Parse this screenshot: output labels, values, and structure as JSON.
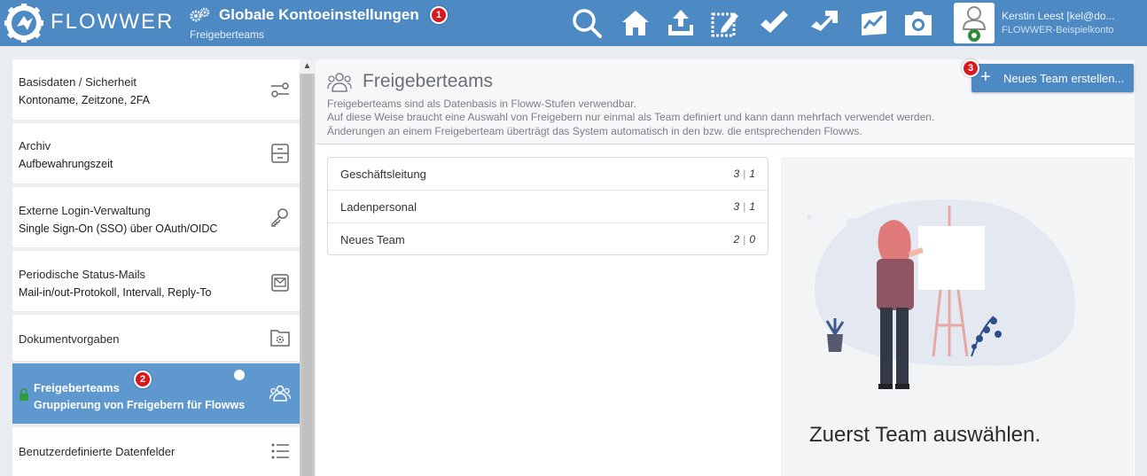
{
  "topbar": {
    "logo_text": "FLOWWER",
    "title": "Globale Kontoeinstellungen",
    "subtitle": "Freigeberteams",
    "icons": [
      "search-icon",
      "home-icon",
      "upload-icon",
      "select-icon",
      "edit-icon",
      "forward-icon",
      "chart-icon",
      "photo-icon"
    ],
    "user_name": "Kerstin Leest [kel@do...",
    "user_account": "FLOWWER-Beispielkonto"
  },
  "badges": {
    "b1": "1",
    "b2": "2",
    "b3": "3"
  },
  "sidebar": {
    "items": [
      {
        "title": "Basisdaten / Sicherheit",
        "sub": "Kontoname, Zeitzone, 2FA",
        "icon": "sliders-icon"
      },
      {
        "title": "Archiv",
        "sub": "Aufbewahrungszeit",
        "icon": "archive-icon"
      },
      {
        "title": "Externe Login-Verwaltung",
        "sub": "Single Sign-On (SSO) über OAuth/OIDC",
        "icon": "key-icon"
      },
      {
        "title": "Periodische Status-Mails",
        "sub": "Mail-in/out-Protokoll, Intervall, Reply-To",
        "icon": "mail-icon"
      },
      {
        "title": "Dokumentvorgaben",
        "sub": "",
        "icon": "folder-gear-icon"
      },
      {
        "title": "Freigeberteams",
        "sub": "Gruppierung von Freigebern für Flowws",
        "icon": "team-icon"
      },
      {
        "title": "Benutzerdefinierte Datenfelder",
        "sub": "",
        "icon": "list-icon"
      }
    ]
  },
  "main": {
    "title": "Freigeberteams",
    "desc": [
      "Freigeberteams sind als Datenbasis in Floww-Stufen verwendbar.",
      "Auf diese Weise braucht eine Auswahl von Freigebern nur einmal als Team definiert und kann dann mehrfach verwendet werden.",
      "Änderungen an einem Freigeberteam überträgt das System automatisch in den bzw. die entsprechenden Flowws."
    ],
    "new_button": "Neues Team erstellen...",
    "teams": [
      {
        "name": "Geschäftsleitung",
        "a": "3",
        "b": "1"
      },
      {
        "name": "Ladenpersonal",
        "a": "3",
        "b": "1"
      },
      {
        "name": "Neues Team",
        "a": "2",
        "b": "0"
      }
    ],
    "empty_text": "Zuerst Team auswählen."
  },
  "colors": {
    "brand": "#4d89c3",
    "active": "#5f98cf",
    "badge": "#d7191f"
  }
}
